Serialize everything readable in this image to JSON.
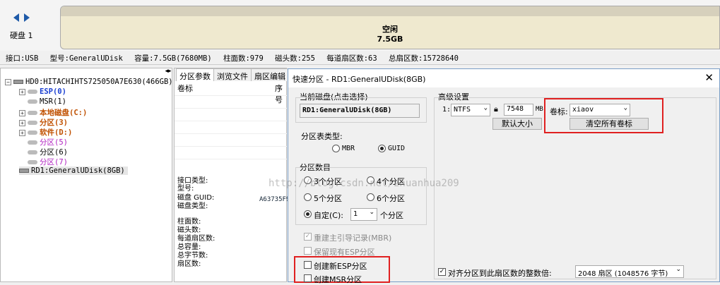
{
  "disk_panel": {
    "disk_label": "硬盘 1",
    "free_title": "空闲",
    "free_size": "7.5GB"
  },
  "info_bar": {
    "interface": "接口:USB",
    "model": "型号:GeneralUDisk",
    "capacity": "容量:7.5GB(7680MB)",
    "cylinders": "柱面数:979",
    "heads": "磁头数:255",
    "sectors_per_track": "每道扇区数:63",
    "total_sectors": "总扇区数:15728640"
  },
  "tree": {
    "hd0": "HD0:HITACHIHTS725050A7E630(466GB)",
    "items": [
      {
        "label": "ESP(0)",
        "style": "blue"
      },
      {
        "label": "MSR(1)",
        "style": "normal"
      },
      {
        "label": "本地磁盘(C:)",
        "style": "orange"
      },
      {
        "label": "分区(3)",
        "style": "orange"
      },
      {
        "label": "软件(D:)",
        "style": "orange"
      },
      {
        "label": "分区(5)",
        "style": "purple"
      },
      {
        "label": "分区(6)",
        "style": "normal"
      },
      {
        "label": "分区(7)",
        "style": "purple"
      }
    ],
    "rd1": "RD1:GeneralUDisk(8GB)"
  },
  "middle": {
    "tabs": [
      "分区参数",
      "浏览文件",
      "扇区编辑"
    ],
    "col_label": "卷标",
    "col_seq": "序号",
    "info_labels": [
      "接口类型:",
      "型号:",
      "磁盘 GUID:",
      "磁盘类型:"
    ],
    "guid_value": "A63735F9",
    "geo_labels": [
      "柱面数:",
      "磁头数:",
      "每道扇区数:",
      "总容量:",
      "总字节数:",
      "扇区数:"
    ]
  },
  "watermark": "http://blog.csdn.net/zhuanhua209",
  "dialog": {
    "title": "快速分区 - RD1:GeneralUDisk(8GB)",
    "current_disk_label": "当前磁盘(点击选择)",
    "current_disk_value": "RD1:GeneralUDisk(8GB)",
    "table_type_label": "分区表类型:",
    "mbr": "MBR",
    "guid": "GUID",
    "count_label": "分区数目",
    "count_options": [
      "3个分区",
      "4个分区",
      "5个分区",
      "6个分区"
    ],
    "custom_label": "自定(C):",
    "custom_value": "1",
    "custom_suffix": "个分区",
    "rebuild_mbr": "重建主引导记录(MBR)",
    "keep_esp": "保留现有ESP分区",
    "create_esp": "创建新ESP分区",
    "create_msr": "创建MSR分区",
    "advanced_label": "高级设置",
    "row_index": "1:",
    "fs_value": "NTFS",
    "size_value": "7548",
    "size_unit": "MB",
    "default_size_btn": "默认大小",
    "volume_label": "卷标:",
    "volume_value": "xiaov",
    "clear_labels_btn": "清空所有卷标",
    "align_label": "对齐分区到此扇区数的整数倍:",
    "align_value": "2048 扇区 (1048576 字节)"
  }
}
